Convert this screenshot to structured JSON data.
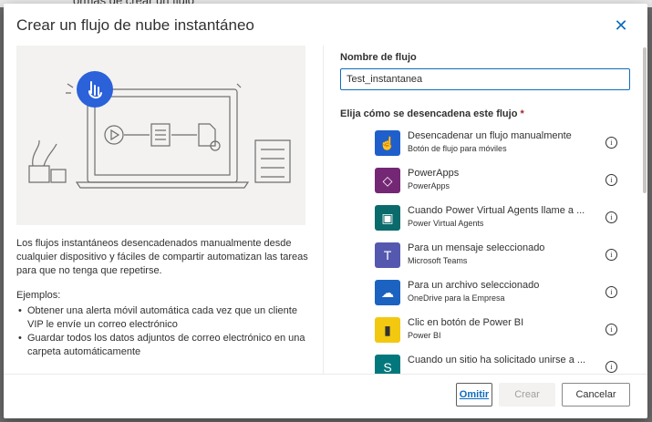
{
  "background": {
    "text": "ormas de crear un flujo"
  },
  "dialog": {
    "title": "Crear un flujo de nube instantáneo",
    "description": "Los flujos instantáneos desencadenados manualmente desde cualquier dispositivo y fáciles de compartir automatizan las tareas para que no tenga que repetirse.",
    "examples_label": "Ejemplos:",
    "examples": [
      "Obtener una alerta móvil automática cada vez que un cliente VIP le envíe un correo electrónico",
      "Guardar todos los datos adjuntos de correo electrónico en una carpeta automáticamente"
    ],
    "flow_name_label": "Nombre de flujo",
    "flow_name_value": "Test_instantanea",
    "trigger_label": "Elija cómo se desencadena este flujo",
    "required_mark": "*",
    "triggers": [
      {
        "title": "Desencadenar un flujo manualmente",
        "subtitle": "Botón de flujo para móviles",
        "icon": "hand-tap-icon",
        "color": "#1f5fcc"
      },
      {
        "title": "PowerApps",
        "subtitle": "PowerApps",
        "icon": "powerapps-icon",
        "color": "#742774"
      },
      {
        "title": "Cuando Power Virtual Agents llame a ...",
        "subtitle": "Power Virtual Agents",
        "icon": "chat-bot-icon",
        "color": "#0b6a6b"
      },
      {
        "title": "Para un mensaje seleccionado",
        "subtitle": "Microsoft Teams",
        "icon": "teams-icon",
        "color": "#5558af"
      },
      {
        "title": "Para un archivo seleccionado",
        "subtitle": "OneDrive para la Empresa",
        "icon": "onedrive-icon",
        "color": "#1b62c1"
      },
      {
        "title": "Clic en botón de Power BI",
        "subtitle": "Power BI",
        "icon": "powerbi-icon",
        "color": "#f2c811"
      },
      {
        "title": "Cuando un sitio ha solicitado unirse a ...",
        "subtitle": "",
        "icon": "sharepoint-icon",
        "color": "#03787c"
      }
    ],
    "buttons": {
      "skip": "Omitir",
      "create": "Crear",
      "cancel": "Cancelar"
    }
  }
}
